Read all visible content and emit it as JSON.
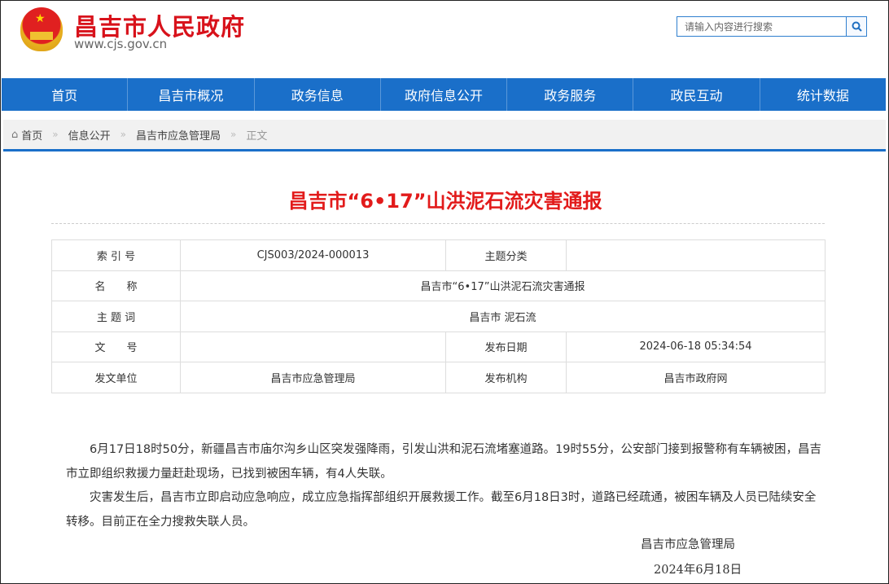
{
  "header": {
    "site_name": "昌吉市人民政府",
    "site_url": "www.cjs.gov.cn",
    "search_placeholder": "请输入内容进行搜索"
  },
  "nav": [
    "首页",
    "昌吉市概况",
    "政务信息",
    "政府信息公开",
    "政务服务",
    "政民互动",
    "统计数据"
  ],
  "breadcrumb": {
    "items": [
      "首页",
      "信息公开",
      "昌吉市应急管理局"
    ],
    "current": "正文",
    "sep": "»"
  },
  "article": {
    "title": "昌吉市“6•17”山洪泥石流灾害通报",
    "meta": {
      "index_label": "索 引 号",
      "index_value": "CJS003/2024-000013",
      "topic_label": "主题分类",
      "topic_value": "",
      "name_label": "名　　称",
      "name_value": "昌吉市“6•17”山洪泥石流灾害通报",
      "keywords_label": "主 题 词",
      "keywords_value": "昌吉市 泥石流",
      "doc_no_label": "文　　号",
      "doc_no_value": "",
      "pub_date_label": "发布日期",
      "pub_date_value": "2024-06-18 05:34:54",
      "issuer_label": "发文单位",
      "issuer_value": "昌吉市应急管理局",
      "publisher_label": "发布机构",
      "publisher_value": "昌吉市政府网"
    },
    "paragraphs": [
      "6月17日18时50分，新疆昌吉市庙尔沟乡山区突发强降雨，引发山洪和泥石流堵塞道路。19时55分，公安部门接到报警称有车辆被困，昌吉市立即组织救援力量赶赴现场，已找到被困车辆，有4人失联。",
      "灾害发生后，昌吉市立即启动应急响应，成立应急指挥部组织开展救援工作。截至6月18日3时，道路已经疏通，被困车辆及人员已陆续安全转移。目前正在全力搜救失联人员。"
    ],
    "signature": "昌吉市应急管理局",
    "date": "2024年6月18日"
  }
}
